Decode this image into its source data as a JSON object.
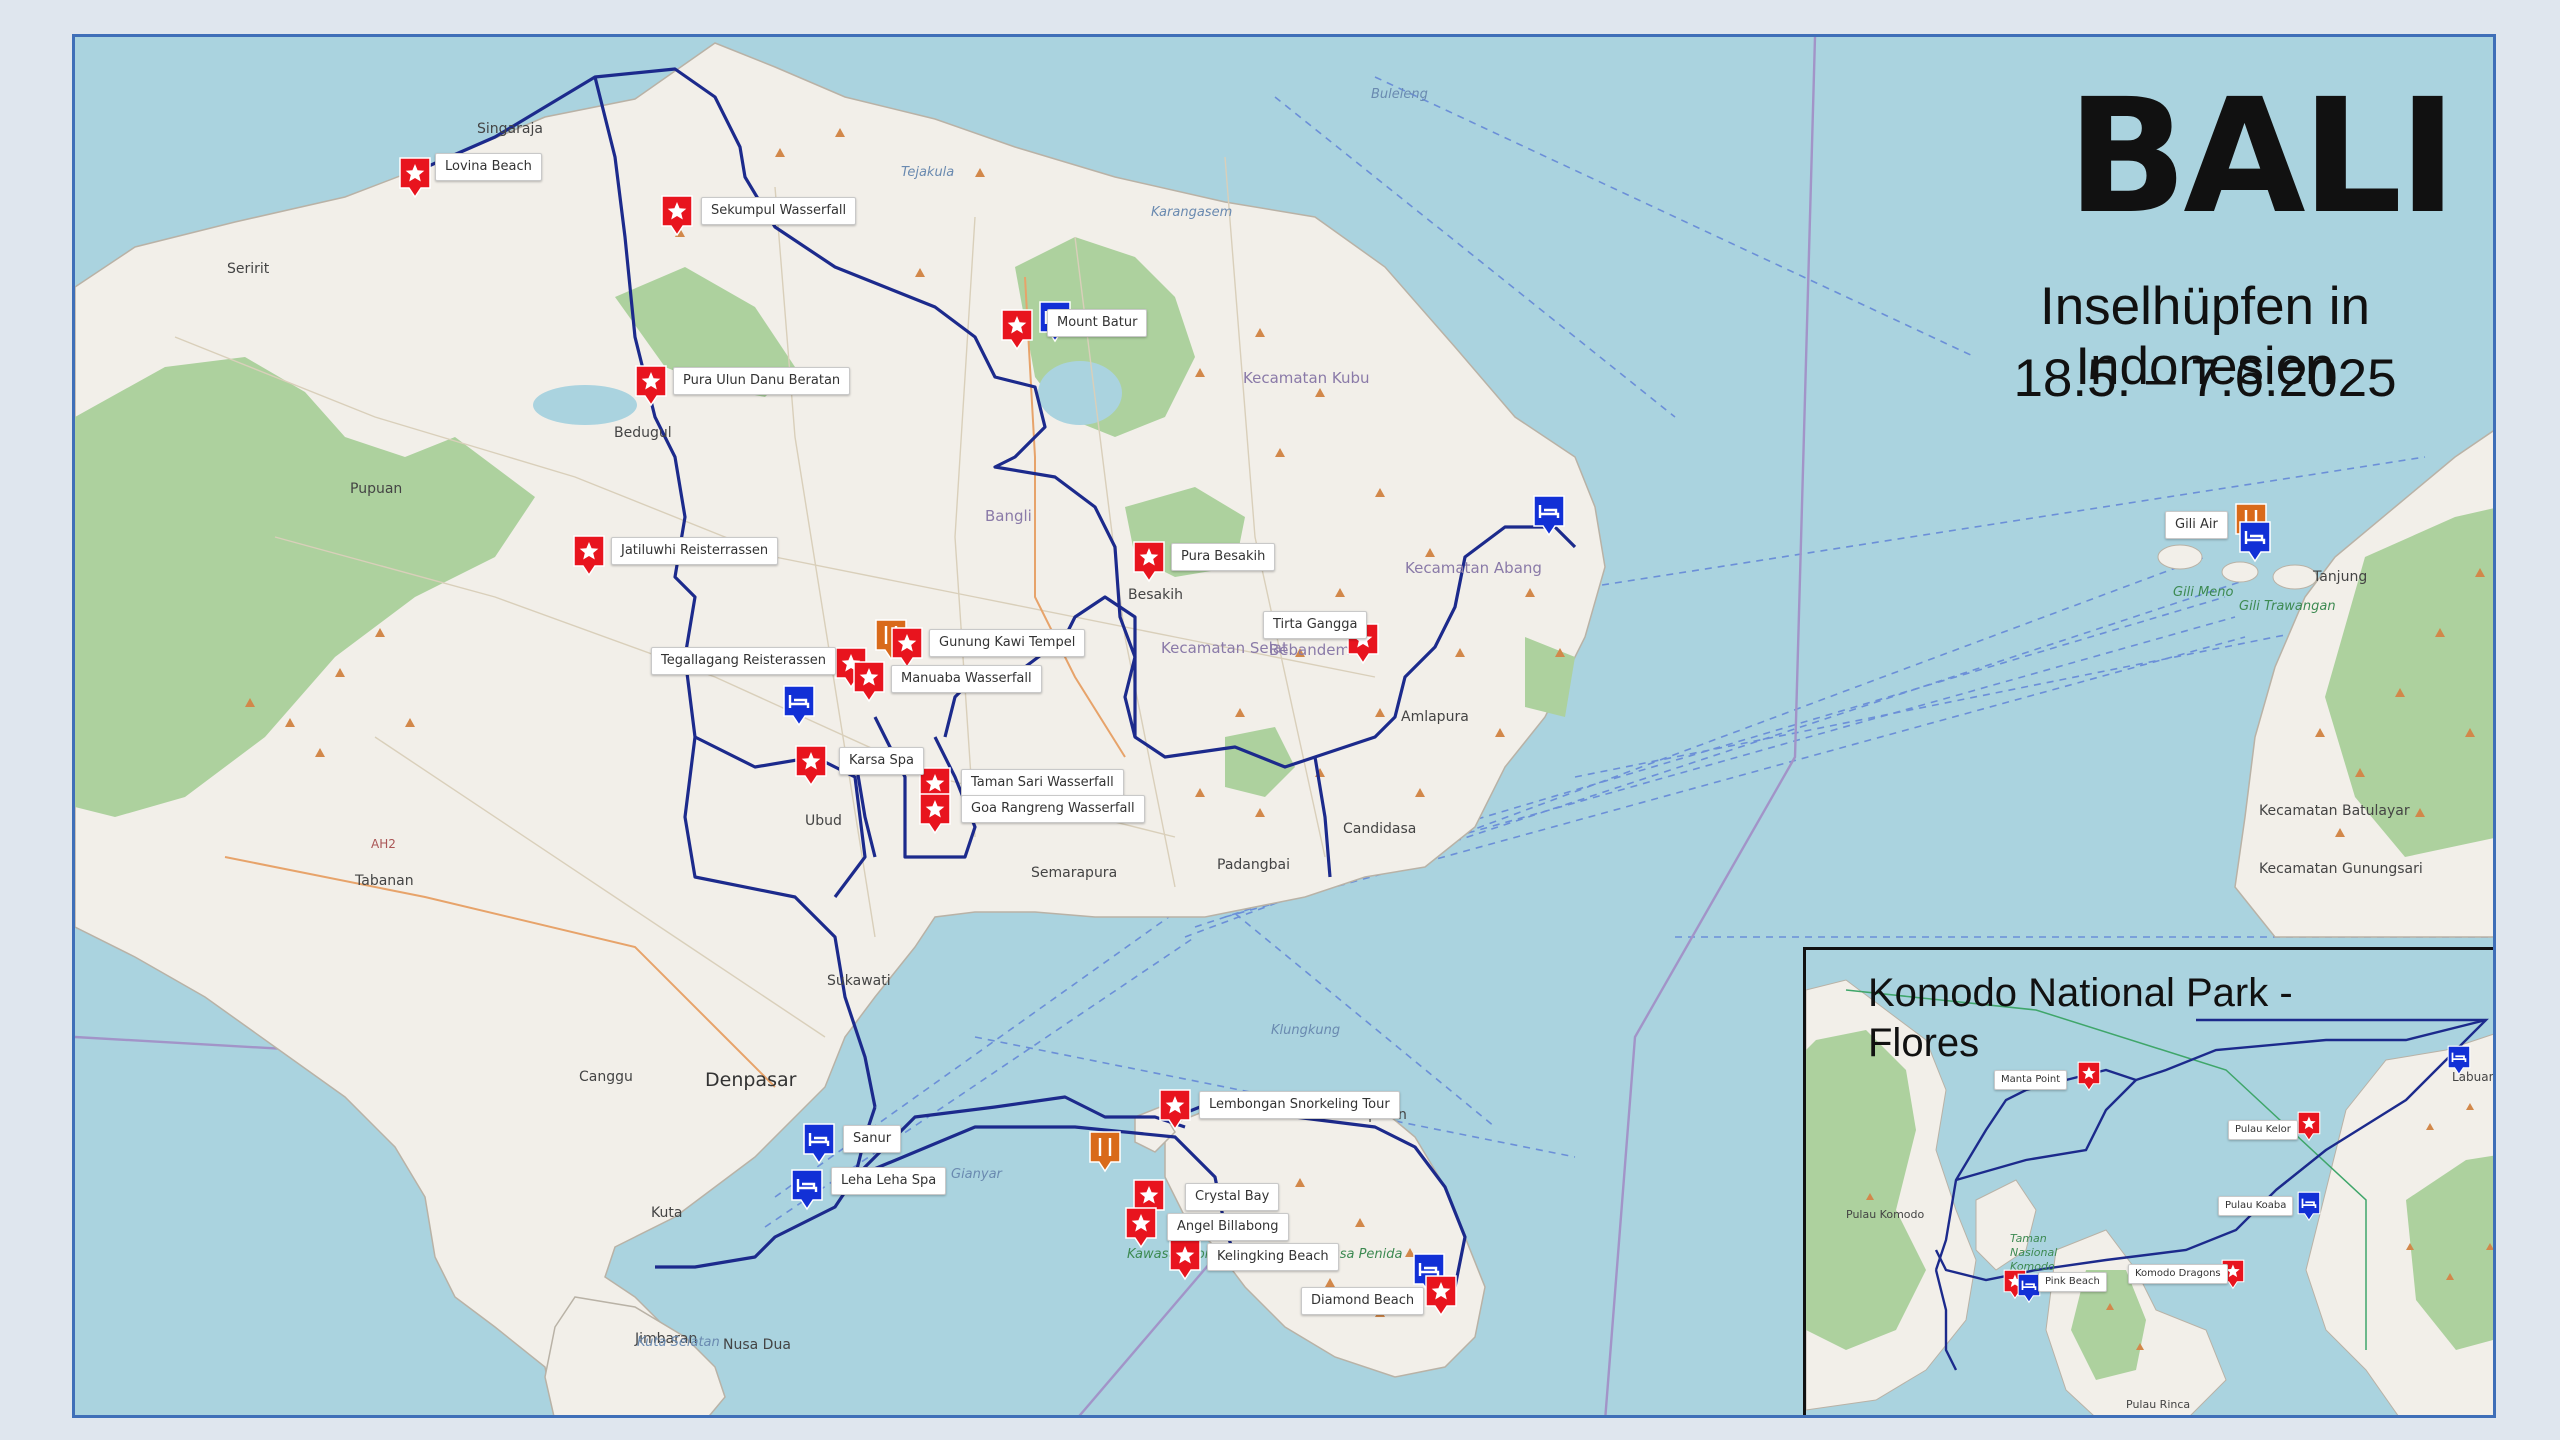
{
  "title": "BALI",
  "subtitle": "Inselhüpfen in Indonesien",
  "dates": "18.5. – 7.6.2025",
  "colors": {
    "sea": "#aad3df",
    "land": "#f2efe9",
    "forest": "#add19e",
    "route": "#1c2a8c",
    "sight_marker": "#e8141e",
    "hotel_marker": "#1230d6",
    "food_marker": "#d96a1a",
    "frame": "#3f6fb8"
  },
  "icons": {
    "sight": "star-icon",
    "hotel": "bed-icon",
    "food": "fork-knife-icon"
  },
  "sights": [
    "Lovina Beach",
    "Sekumpul Wasserfall",
    "Mount Batur",
    "Pura Ulun Danu Beratan",
    "Jatiluwhi Reisterrassen",
    "Pura Besakih",
    "Tirta Gangga",
    "Gunung Kawi Tempel",
    "Tegallagang Reisterassen",
    "Manuaba Wasserfall",
    "Karsa Spa",
    "Taman Sari Wasserfall",
    "Goa Rangreng Wasserfall",
    "Lembongan Snorkeling Tour",
    "Sanur",
    "Leha Leha Spa",
    "Crystal Bay",
    "Angel Billabong",
    "Kelingking Beach",
    "Diamond Beach",
    "Gili Air"
  ],
  "places": [
    "Singaraja",
    "Seririt",
    "Pupuan",
    "Bedugul",
    "Bangli",
    "Besakih",
    "Amlapura",
    "Candidasa",
    "Padangbai",
    "Semarapura",
    "Ubud",
    "Tabanan",
    "Sukawati",
    "Denpasar",
    "Canggu",
    "Kuta",
    "Jimbaran",
    "Nusa Dua",
    "Gianyar",
    "Sampalan",
    "Tanjung",
    "Kecamatan Batulayar",
    "Kecamatan Gunungsari"
  ],
  "places_minor": [
    "Kecamatan Kubu",
    "Kecamatan Abang",
    "Kecamatan Selat",
    "Bebandem",
    "AH2",
    "Kawasan Konservasi Perairan Nusa Penida",
    "Gili Meno",
    "Gili Trawangan",
    "Buleleng",
    "Karangasem",
    "Klungkung",
    "Tejakula",
    "Kuta Selatan"
  ],
  "inset": {
    "title": "Komodo National Park - Flores",
    "labels": [
      "Manta Point",
      "Pulau Kelor",
      "Pulau Koaba",
      "Pink Beach",
      "Komodo Dragons"
    ],
    "places": [
      "Pulau Komodo",
      "Taman Nasional Komodo",
      "Pulau Rinca",
      "Labuan Bajo"
    ]
  }
}
